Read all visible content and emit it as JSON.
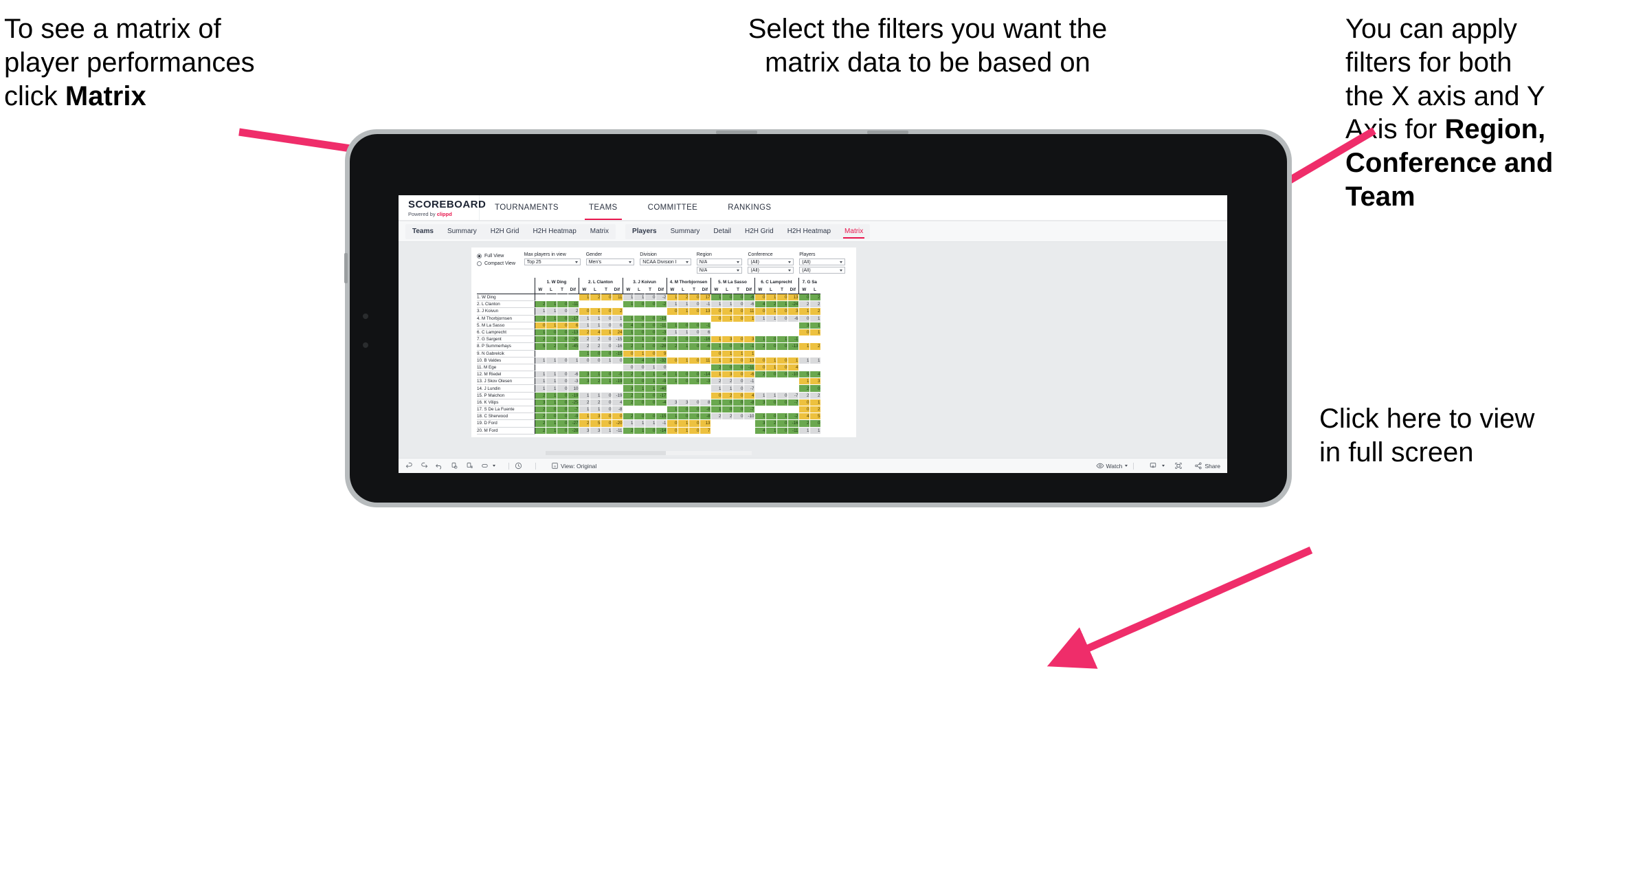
{
  "annotations": {
    "matrix_hint": {
      "line1": "To see a matrix of",
      "line2": "player performances",
      "line3_pre": "click ",
      "line3_bold": "Matrix"
    },
    "filters_hint": {
      "line1": "Select the filters you want the",
      "line2": "matrix data to be based on"
    },
    "axis_hint": {
      "line1": "You  can apply",
      "line2": "filters for both",
      "line3": "the X axis and Y",
      "line4_pre": "Axis for ",
      "line4_bold": "Region,",
      "line5_bold": "Conference and",
      "line6_bold": "Team"
    },
    "fullscreen_hint": {
      "line1": "Click here to view",
      "line2": "in full screen"
    }
  },
  "app": {
    "logo": {
      "name": "SCOREBOARD",
      "powered_pre": "Powered by ",
      "powered_brand": "clippd"
    },
    "top_nav": [
      {
        "label": "TOURNAMENTS",
        "active": false
      },
      {
        "label": "TEAMS",
        "active": true
      },
      {
        "label": "COMMITTEE",
        "active": false
      },
      {
        "label": "RANKINGS",
        "active": false
      }
    ],
    "sub_nav_teams": [
      {
        "label": "Teams",
        "head": true
      },
      {
        "label": "Summary"
      },
      {
        "label": "H2H Grid"
      },
      {
        "label": "H2H Heatmap"
      },
      {
        "label": "Matrix"
      }
    ],
    "sub_nav_players": [
      {
        "label": "Players",
        "head": true
      },
      {
        "label": "Summary"
      },
      {
        "label": "Detail"
      },
      {
        "label": "H2H Grid"
      },
      {
        "label": "H2H Heatmap"
      },
      {
        "label": "Matrix",
        "active": true
      }
    ],
    "accent_color": "#e8174e"
  },
  "filters": {
    "view_options": [
      {
        "label": "Full View",
        "selected": true
      },
      {
        "label": "Compact View",
        "selected": false
      }
    ],
    "fields": [
      {
        "label": "Max players in view",
        "values": [
          "Top 25"
        ]
      },
      {
        "label": "Gender",
        "values": [
          "Men's"
        ]
      },
      {
        "label": "Division",
        "values": [
          "NCAA Division I"
        ]
      },
      {
        "label": "Region",
        "values": [
          "N/A",
          "N/A"
        ]
      },
      {
        "label": "Conference",
        "values": [
          "(All)",
          "(All)"
        ]
      },
      {
        "label": "Players",
        "values": [
          "(All)",
          "(All)"
        ]
      }
    ]
  },
  "matrix": {
    "sub_headers": [
      "W",
      "L",
      "T",
      "Dif"
    ],
    "columns": [
      "1. W Ding",
      "2. L Clanton",
      "3. J Koivun",
      "4. M Thorbjornsen",
      "5. M La Sasso",
      "6. C Lamprecht",
      "7. G Sa"
    ],
    "rows": [
      "1. W Ding",
      "2. L Clanton",
      "3. J Koivun",
      "4. M Thorbjornsen",
      "5. M La Sasso",
      "6. C Lamprecht",
      "7. G Sargent",
      "8. P Summerhays",
      "9. N Gabrelcik",
      "10. B Valdes",
      "11. M Ege",
      "12. M Riedel",
      "13. J Skov Olesen",
      "14. J Lundin",
      "15. P Maichon",
      "16. K Vilips",
      "17. S De La Fuente",
      "18. C Sherwood",
      "19. D Ford",
      "20. M Ford"
    ],
    "cells": [
      [
        null,
        [
          "1",
          "2",
          "0",
          "11",
          "y"
        ],
        [
          "1",
          "1",
          "0",
          "-2",
          "n"
        ],
        [
          "1",
          "2",
          "0",
          "17",
          "y"
        ],
        [
          "1",
          "0",
          "0",
          "-6",
          "g"
        ],
        [
          "0",
          "1",
          "0",
          "13",
          "y"
        ],
        [
          "0",
          "2",
          "g"
        ]
      ],
      [
        [
          "2",
          "1",
          "0",
          "-11",
          "g"
        ],
        null,
        [
          "1",
          "0",
          "0",
          "-2",
          "g"
        ],
        [
          "1",
          "1",
          "0",
          "-1",
          "n"
        ],
        [
          "1",
          "1",
          "0",
          "-6",
          "n"
        ],
        [
          "4",
          "2",
          "1",
          "-24",
          "g"
        ],
        [
          "2",
          "2",
          "n"
        ]
      ],
      [
        [
          "1",
          "1",
          "0",
          "2",
          "n"
        ],
        [
          "0",
          "1",
          "0",
          "2",
          "y"
        ],
        null,
        [
          "0",
          "1",
          "0",
          "13",
          "y"
        ],
        [
          "0",
          "4",
          "0",
          "11",
          "y"
        ],
        [
          "0",
          "1",
          "0",
          "3",
          "y"
        ],
        [
          "1",
          "2",
          "y"
        ]
      ],
      [
        [
          "2",
          "1",
          "0",
          "-17",
          "g"
        ],
        [
          "1",
          "1",
          "0",
          "1",
          "n"
        ],
        [
          "1",
          "0",
          "0",
          "-13",
          "g"
        ],
        null,
        [
          "0",
          "1",
          "0",
          "1",
          "y"
        ],
        [
          "1",
          "1",
          "0",
          "-6",
          "n"
        ],
        [
          "0",
          "1",
          "n"
        ]
      ],
      [
        [
          "0",
          "1",
          "0",
          "6",
          "y"
        ],
        [
          "1",
          "1",
          "0",
          "6",
          "n"
        ],
        [
          "4",
          "0",
          "0",
          "-11",
          "g"
        ],
        [
          "1",
          "0",
          "0",
          "-1",
          "g"
        ],
        null,
        null,
        [
          "3",
          "1",
          "g"
        ]
      ],
      [
        [
          "1",
          "0",
          "0",
          "-13",
          "g"
        ],
        [
          "2",
          "4",
          "1",
          "24",
          "y"
        ],
        [
          "1",
          "0",
          "0",
          "-3",
          "g"
        ],
        [
          "1",
          "1",
          "0",
          "6",
          "n"
        ],
        null,
        null,
        [
          "0",
          "1",
          "y"
        ]
      ],
      [
        [
          "2",
          "0",
          "0",
          "-25",
          "g"
        ],
        [
          "2",
          "2",
          "0",
          "-15",
          "n"
        ],
        [
          "2",
          "1",
          "0",
          "-6",
          "g"
        ],
        [
          "1",
          "0",
          "0",
          "-16",
          "g"
        ],
        [
          "1",
          "3",
          "0",
          "3",
          "y"
        ],
        [
          "1",
          "0",
          "1",
          "-1",
          "g"
        ],
        null
      ],
      [
        [
          "5",
          "2",
          "0",
          "-45",
          "g"
        ],
        [
          "2",
          "2",
          "0",
          "-16",
          "n"
        ],
        [
          "2",
          "1",
          "0",
          "-28",
          "g"
        ],
        [
          "2",
          "1",
          "0",
          "-6",
          "g"
        ],
        [
          "1",
          "0",
          "0",
          "-1",
          "g"
        ],
        [
          "2",
          "0",
          "0",
          "-13",
          "g"
        ],
        [
          "1",
          "2",
          "y"
        ]
      ],
      [
        null,
        [
          "1",
          "0",
          "0",
          "-15",
          "g"
        ],
        [
          "0",
          "1",
          "0",
          "9",
          "y"
        ],
        null,
        [
          "0",
          "1",
          "1",
          "1",
          "y"
        ],
        null,
        null
      ],
      [
        [
          "1",
          "1",
          "0",
          "1",
          "n"
        ],
        [
          "0",
          "0",
          "1",
          "0",
          "n"
        ],
        [
          "7",
          "4",
          "0",
          "-32",
          "g"
        ],
        [
          "0",
          "1",
          "0",
          "11",
          "y"
        ],
        [
          "1",
          "3",
          "0",
          "13",
          "y"
        ],
        [
          "0",
          "1",
          "0",
          "1",
          "y"
        ],
        [
          "1",
          "1",
          "n"
        ]
      ],
      [
        null,
        null,
        [
          "0",
          "0",
          "1",
          "0",
          "n"
        ],
        null,
        [
          "2",
          "0",
          "0",
          "-11",
          "g"
        ],
        [
          "0",
          "1",
          "0",
          "4",
          "y"
        ],
        null
      ],
      [
        [
          "1",
          "1",
          "0",
          "-6",
          "n"
        ],
        [
          "3",
          "1",
          "0",
          "-5",
          "g"
        ],
        [
          "2",
          "0",
          "1",
          "-6",
          "g"
        ],
        [
          "1",
          "0",
          "0",
          "-14",
          "g"
        ],
        [
          "1",
          "3",
          "0",
          "-6",
          "y"
        ],
        [
          "2",
          "0",
          "0",
          "-10",
          "g"
        ],
        [
          "5",
          "4",
          "g"
        ]
      ],
      [
        [
          "1",
          "1",
          "0",
          "-3",
          "n"
        ],
        [
          "3",
          "2",
          "1",
          "-19",
          "g"
        ],
        [
          "1",
          "0",
          "1",
          "-9",
          "g"
        ],
        [
          "1",
          "0",
          "0",
          "-3",
          "g"
        ],
        [
          "2",
          "2",
          "0",
          "-1",
          "n"
        ],
        null,
        [
          "1",
          "3",
          "y"
        ]
      ],
      [
        [
          "1",
          "1",
          "0",
          "10",
          "n"
        ],
        null,
        [
          "3",
          "1",
          "1",
          "-40",
          "g"
        ],
        null,
        [
          "1",
          "1",
          "0",
          "-7",
          "n"
        ],
        null,
        [
          "2",
          "0",
          "g"
        ]
      ],
      [
        [
          "2",
          "1",
          "0",
          "-19",
          "g"
        ],
        [
          "1",
          "1",
          "0",
          "-19",
          "n"
        ],
        [
          "2",
          "1",
          "0",
          "-17",
          "g"
        ],
        null,
        [
          "0",
          "2",
          "0",
          "4",
          "y"
        ],
        [
          "1",
          "1",
          "0",
          "-7",
          "n"
        ],
        [
          "2",
          "2",
          "n"
        ]
      ],
      [
        [
          "3",
          "1",
          "0",
          "-25",
          "g"
        ],
        [
          "2",
          "2",
          "0",
          "4",
          "n"
        ],
        [
          "2",
          "0",
          "0",
          "-4",
          "g"
        ],
        [
          "3",
          "3",
          "0",
          "8",
          "n"
        ],
        [
          "1",
          "0",
          "0",
          "-8",
          "g"
        ],
        [
          "3",
          "0",
          "0",
          "-7",
          "g"
        ],
        [
          "0",
          "1",
          "y"
        ]
      ],
      [
        [
          "2",
          "0",
          "0",
          "-7",
          "g"
        ],
        [
          "1",
          "1",
          "0",
          "-8",
          "n"
        ],
        null,
        [
          "1",
          "0",
          "0",
          "-8",
          "g"
        ],
        [
          "1",
          "0",
          "0",
          "-7",
          "g"
        ],
        null,
        [
          "0",
          "2",
          "y"
        ]
      ],
      [
        [
          "2",
          "0",
          "0",
          "-9",
          "g"
        ],
        [
          "1",
          "3",
          "0",
          "0",
          "y"
        ],
        [
          "2",
          "0",
          "0",
          "-15",
          "g"
        ],
        [
          "1",
          "0",
          "0",
          "-8",
          "g"
        ],
        [
          "2",
          "2",
          "0",
          "-10",
          "n"
        ],
        [
          "1",
          "0",
          "1",
          "-2",
          "g"
        ],
        [
          "4",
          "5",
          "y"
        ]
      ],
      [
        [
          "2",
          "1",
          "0",
          "-27",
          "g"
        ],
        [
          "2",
          "5",
          "0",
          "-20",
          "y"
        ],
        [
          "1",
          "1",
          "1",
          "-1",
          "n"
        ],
        [
          "0",
          "1",
          "0",
          "13",
          "y"
        ],
        null,
        [
          "3",
          "2",
          "0",
          "-16",
          "g"
        ],
        [
          "2",
          "0",
          "g"
        ]
      ],
      [
        [
          "2",
          "1",
          "0",
          "-28",
          "g"
        ],
        [
          "3",
          "3",
          "1",
          "-11",
          "n"
        ],
        [
          "2",
          "1",
          "0",
          "-14",
          "g"
        ],
        [
          "0",
          "1",
          "0",
          "7",
          "y"
        ],
        null,
        [
          "4",
          "1",
          "0",
          "-11",
          "g"
        ],
        [
          "1",
          "1",
          "n"
        ]
      ]
    ]
  },
  "toolbar": {
    "view_label": "View: Original",
    "watch_label": "Watch",
    "share_label": "Share"
  }
}
